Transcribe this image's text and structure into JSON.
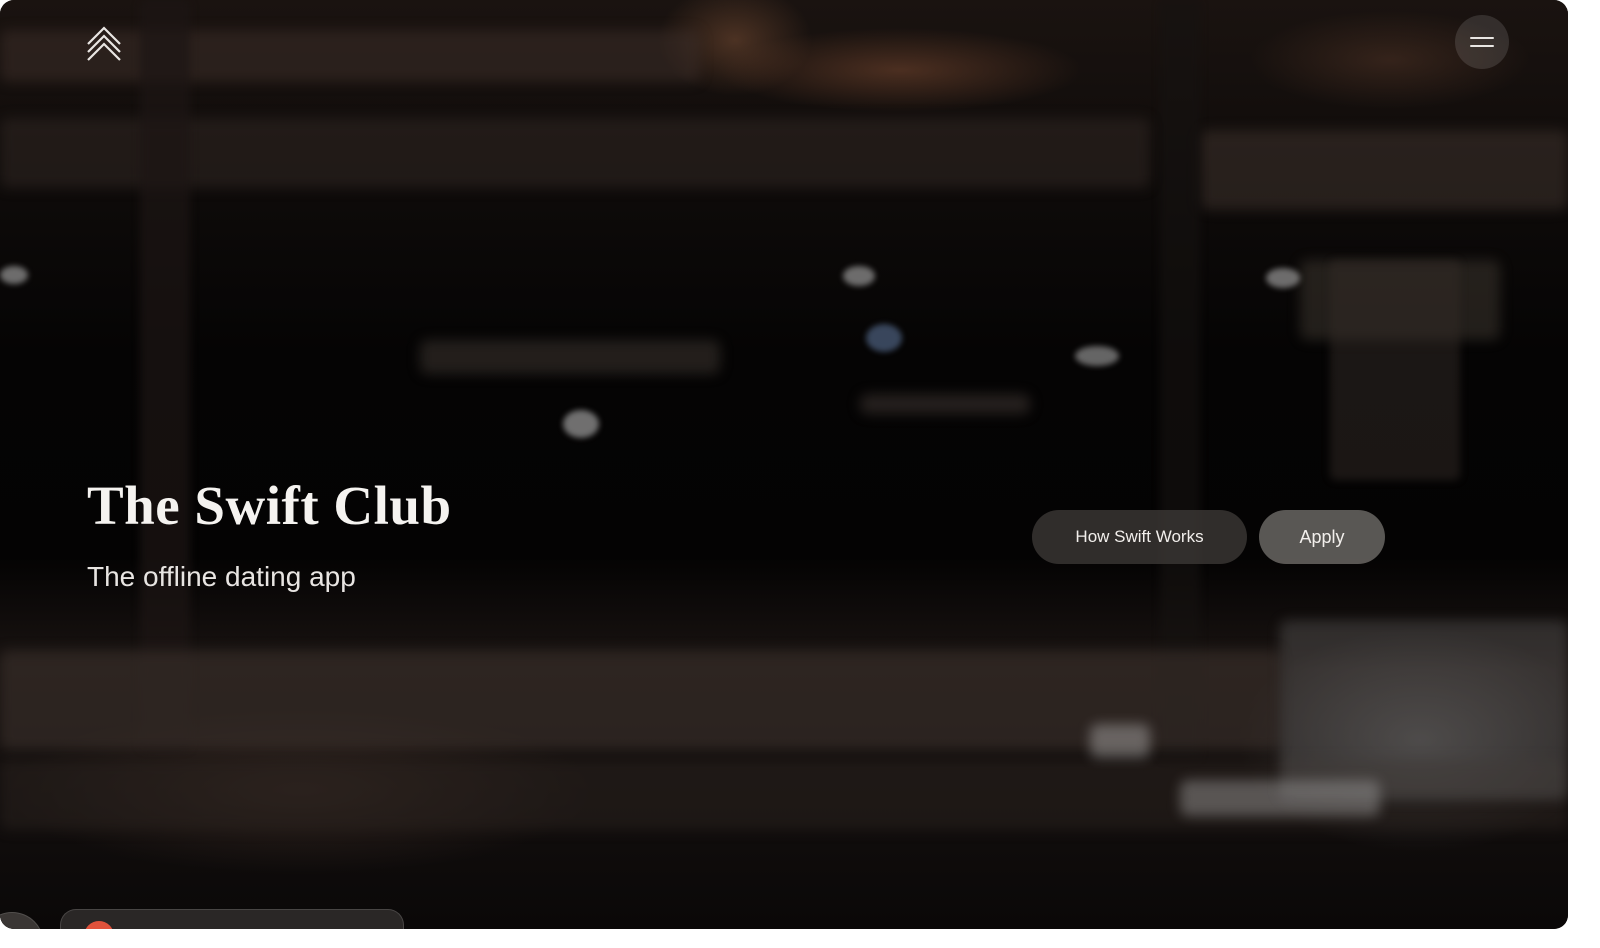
{
  "hero": {
    "title": "The Swift Club",
    "subtitle": "The offline dating app"
  },
  "header": {
    "logo_icon": "chevron-up-double-icon",
    "menu_icon": "hamburger-menu-icon"
  },
  "cta": {
    "how_label": "How Swift Works",
    "apply_label": "Apply"
  },
  "colors": {
    "background": "#0a0807",
    "text": "#f5f3f0",
    "secondary_button": "#3a3735",
    "primary_button": "#a09c98",
    "badge_dot": "#e0523b"
  }
}
